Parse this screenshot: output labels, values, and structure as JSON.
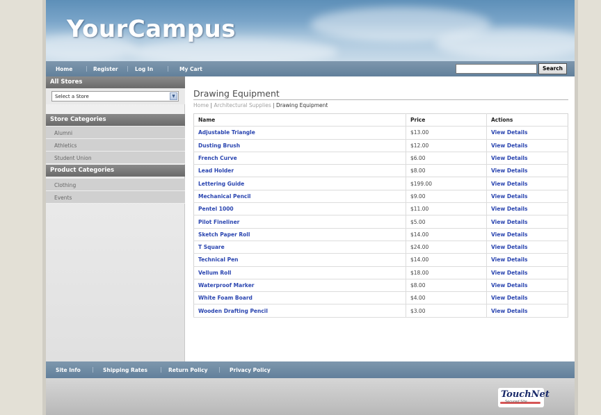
{
  "header": {
    "logo": "YourCampus"
  },
  "nav": {
    "links": [
      "Home",
      "Register",
      "Log In",
      "My Cart"
    ],
    "search_value": "",
    "search_button": "Search"
  },
  "sidebar": {
    "all_stores_heading": "All Stores",
    "store_select_value": "Select a Store",
    "store_categories_heading": "Store Categories",
    "store_categories": [
      "Alumni",
      "Athletics",
      "Student Union"
    ],
    "product_categories_heading": "Product Categories",
    "product_categories": [
      "Clothing",
      "Events"
    ]
  },
  "main": {
    "title": "Drawing Equipment",
    "breadcrumb": [
      "Home",
      "Architectural Supplies",
      "Drawing Equipment"
    ],
    "columns": [
      "Name",
      "Price",
      "Actions"
    ],
    "action_label": "View Details",
    "products": [
      {
        "name": "Adjustable Triangle",
        "price": "$13.00"
      },
      {
        "name": "Dusting Brush",
        "price": "$12.00"
      },
      {
        "name": "French Curve",
        "price": "$6.00"
      },
      {
        "name": "Lead Holder",
        "price": "$8.00"
      },
      {
        "name": "Lettering Guide",
        "price": "$199.00"
      },
      {
        "name": "Mechanical Pencil",
        "price": "$9.00"
      },
      {
        "name": "Pentel 1000",
        "price": "$11.00"
      },
      {
        "name": "Pilot Fineliner",
        "price": "$5.00"
      },
      {
        "name": "Sketch Paper Roll",
        "price": "$14.00"
      },
      {
        "name": "T Square",
        "price": "$24.00"
      },
      {
        "name": "Technical Pen",
        "price": "$14.00"
      },
      {
        "name": "Vellum Roll",
        "price": "$18.00"
      },
      {
        "name": "Waterproof Marker",
        "price": "$8.00"
      },
      {
        "name": "White Foam Board",
        "price": "$4.00"
      },
      {
        "name": "Wooden Drafting Pencil",
        "price": "$3.00"
      }
    ]
  },
  "footer": {
    "links": [
      "Site Info",
      "Shipping Rates",
      "Return Policy",
      "Privacy Policy"
    ],
    "badge_title": "TouchNet",
    "badge_subtitle": "Secured Site"
  },
  "colors": {
    "nav_bar": "#6f8ba5",
    "link": "#2a45b0",
    "sidebar_heading": "#7a7a7a"
  }
}
